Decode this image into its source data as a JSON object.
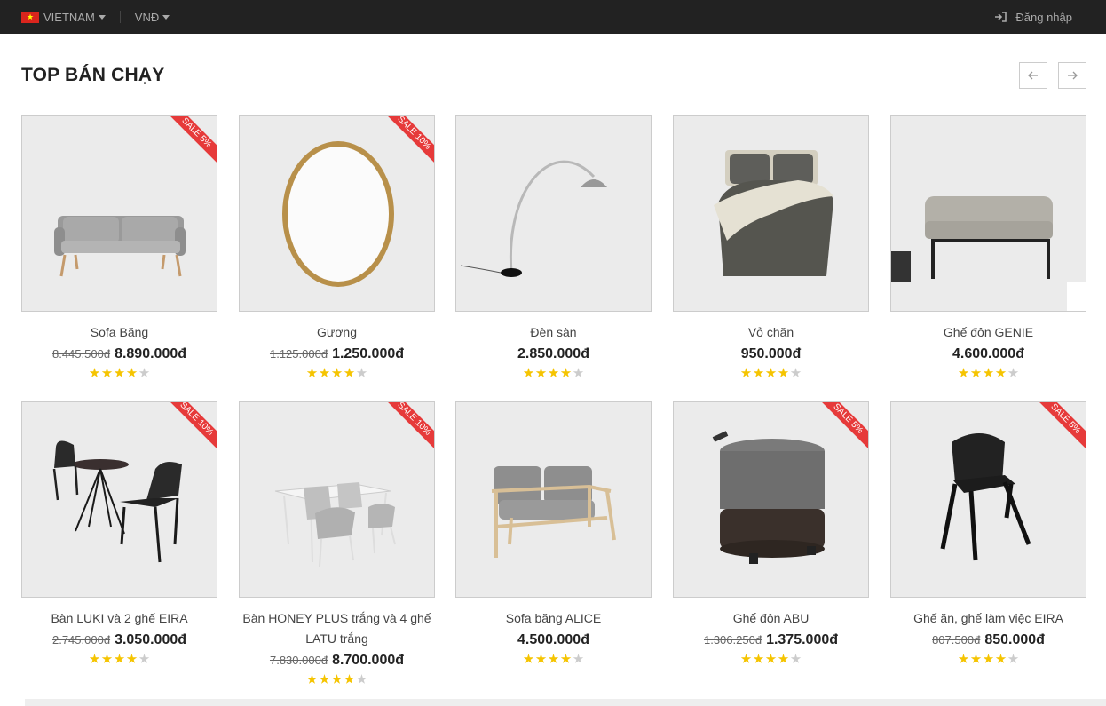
{
  "topbar": {
    "country": "VIETNAM",
    "currency": "VNĐ",
    "login": "Đăng nhập"
  },
  "section": {
    "title": "TOP BÁN CHẠY"
  },
  "products": [
    {
      "name": "Sofa Băng",
      "old_price": "8.445.500đ",
      "price": "8.890.000đ",
      "sale": "SALE 5%",
      "rating": 4,
      "image": "gray-sofa"
    },
    {
      "name": "Gương",
      "old_price": "1.125.000đ",
      "price": "1.250.000đ",
      "sale": "SALE 10%",
      "rating": 4,
      "image": "round-mirror"
    },
    {
      "name": "Đèn sàn",
      "old_price": "",
      "price": "2.850.000đ",
      "sale": "",
      "rating": 4,
      "image": "arc-floor-lamp"
    },
    {
      "name": "Vỏ chăn",
      "old_price": "",
      "price": "950.000đ",
      "sale": "",
      "rating": 4,
      "image": "bed-cover"
    },
    {
      "name": "Ghế đôn GENIE",
      "old_price": "",
      "price": "4.600.000đ",
      "sale": "",
      "rating": 4,
      "image": "ottoman"
    },
    {
      "name": "Bàn LUKI và 2 ghế EIRA",
      "old_price": "2.745.000đ",
      "price": "3.050.000đ",
      "sale": "SALE 10%",
      "rating": 4,
      "image": "table-two-chairs"
    },
    {
      "name": "Bàn HONEY PLUS trắng và 4 ghế LATU trắng",
      "old_price": "7.830.000đ",
      "price": "8.700.000đ",
      "sale": "SALE 10%",
      "rating": 4,
      "image": "dining-set"
    },
    {
      "name": "Sofa băng ALICE",
      "old_price": "",
      "price": "4.500.000đ",
      "sale": "",
      "rating": 4,
      "image": "wood-sofa"
    },
    {
      "name": "Ghế đôn ABU",
      "old_price": "1.306.250đ",
      "price": "1.375.000đ",
      "sale": "SALE 5%",
      "rating": 4,
      "image": "pouf"
    },
    {
      "name": "Ghế ăn, ghế làm việc EIRA",
      "old_price": "807.500đ",
      "price": "850.000đ",
      "sale": "SALE 5%",
      "rating": 4,
      "image": "black-chair"
    }
  ],
  "colors": {
    "topbar_bg": "#222222",
    "sale_ribbon": "#e63a3a",
    "star_on": "#f5c400",
    "star_off": "#cccccc"
  }
}
